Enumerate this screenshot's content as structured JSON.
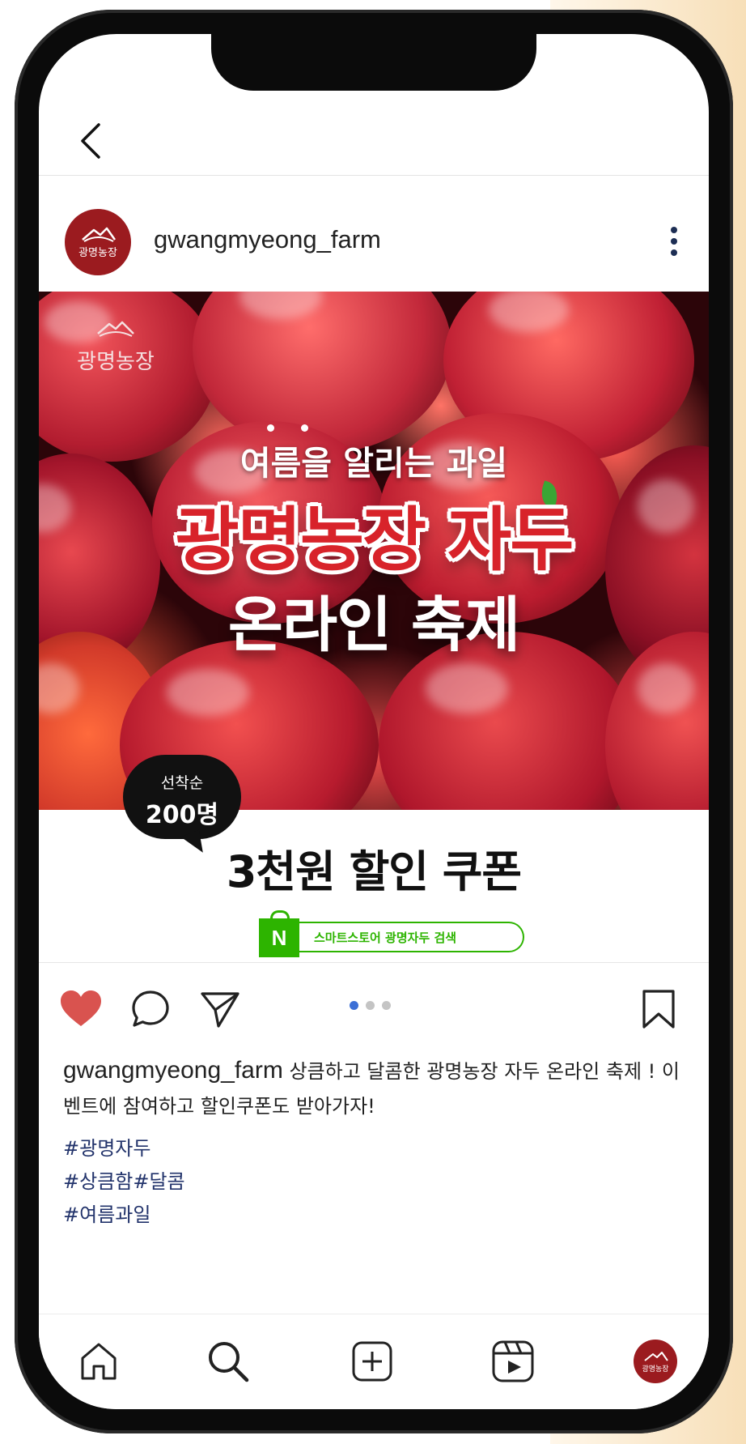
{
  "profile": {
    "username": "gwangmyeong_farm",
    "avatar_label": "광명농장"
  },
  "post_image": {
    "logo_text": "광명농장",
    "headline_small": "여름을 알리는 과일",
    "headline_main": "광명농장 자두",
    "headline_sub": "온라인 축제",
    "badge_line1": "선착순",
    "badge_line2": "200명",
    "coupon_title": "3천원 할인 쿠폰",
    "naver_letter": "N",
    "naver_search_text": "스마트스토어 광명자두 검색"
  },
  "carousel": {
    "total": 3,
    "active": 1
  },
  "caption": {
    "username": "gwangmyeong_farm",
    "text": " 상큼하고 달콤한 광명농장 자두 온라인 축제 ! 이벤트에 참여하고 할인쿠폰도 받아가자!"
  },
  "hashtags": [
    "#광명자두",
    "#상큼함#달콤",
    "#여름과일"
  ],
  "icons": {
    "back": "chevron-left-icon",
    "more": "more-vertical-icon",
    "like": "heart-icon",
    "comment": "comment-icon",
    "share": "send-icon",
    "save": "bookmark-icon",
    "nav": [
      "home-icon",
      "search-icon",
      "add-post-icon",
      "reels-icon",
      "profile-avatar"
    ]
  },
  "colors": {
    "brand": "#9b1b1f",
    "like": "#d9534f",
    "naver_green": "#2db400",
    "hashtag": "#22336b",
    "headline_red": "#d8232a"
  }
}
